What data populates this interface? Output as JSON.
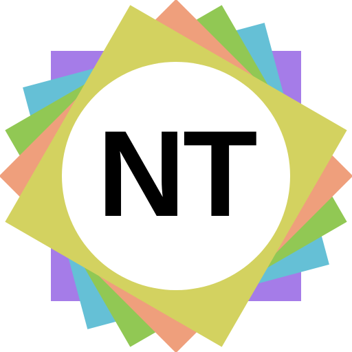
{
  "logo": {
    "text": "NT",
    "colors": {
      "purple": "#a57ce8",
      "blue": "#65c0d6",
      "green": "#91c854",
      "orange": "#ef9f7c",
      "yellow_green": "#d3d260",
      "circle": "#ffffff",
      "text": "#000000"
    }
  }
}
